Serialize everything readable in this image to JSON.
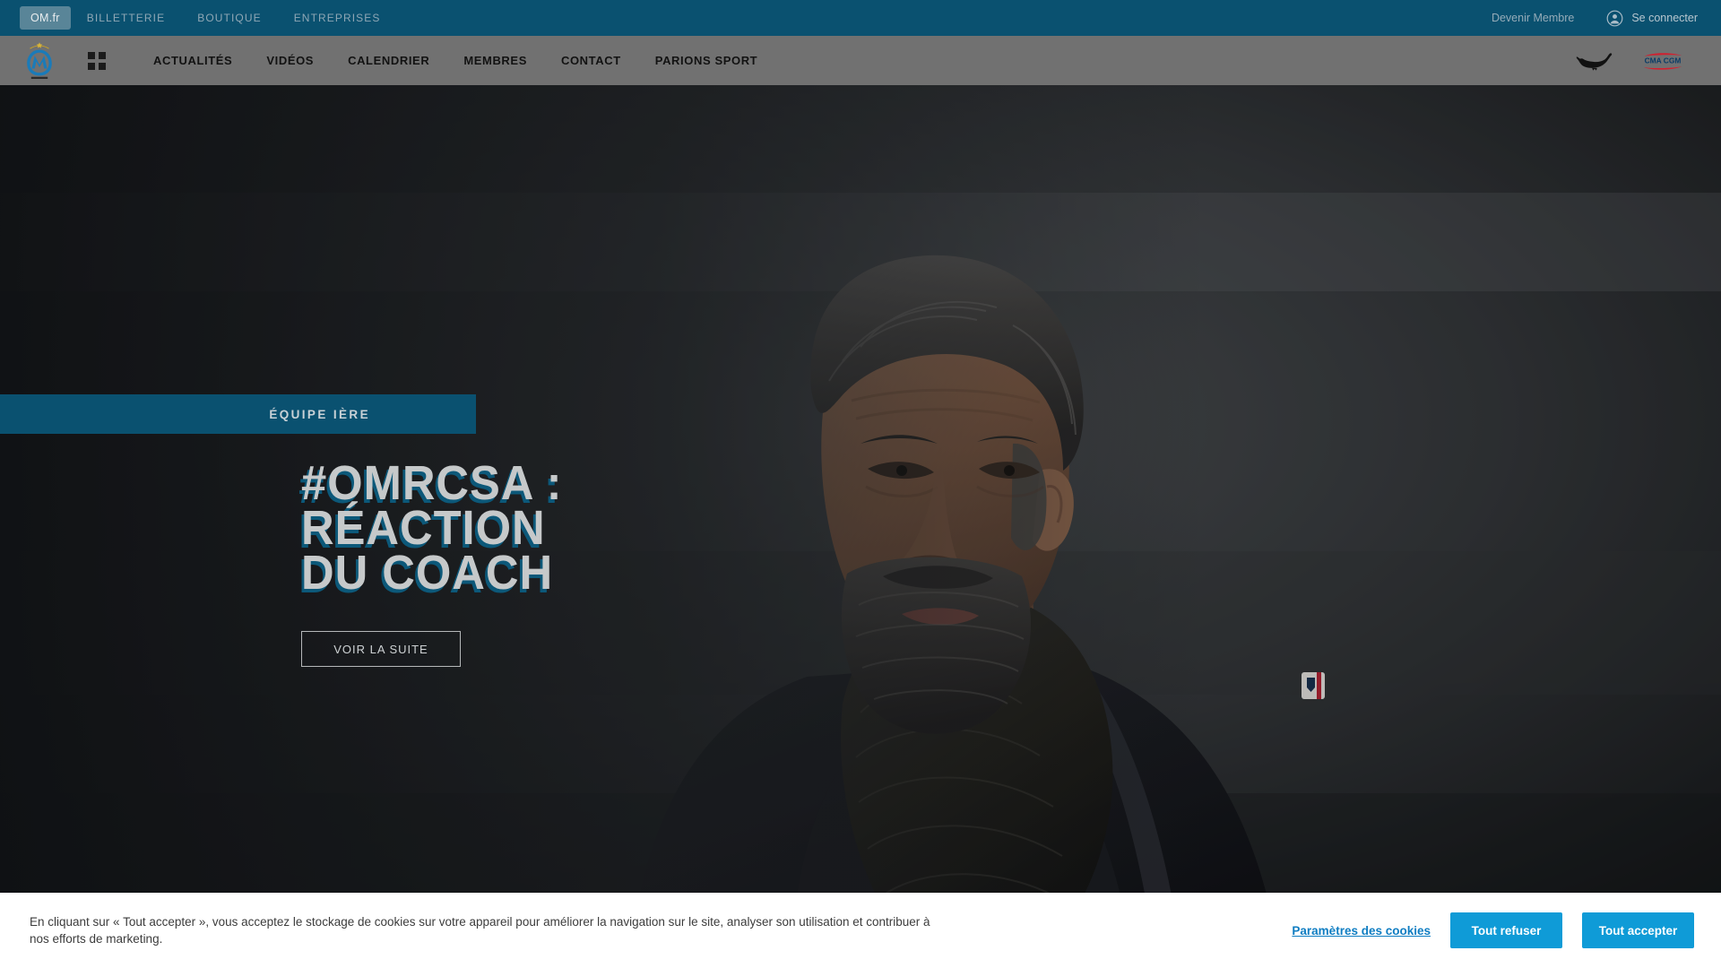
{
  "topbar": {
    "brand_pill": "OM.fr",
    "links": [
      {
        "label": "BILLETTERIE"
      },
      {
        "label": "BOUTIQUE"
      },
      {
        "label": "ENTREPRISES"
      }
    ],
    "member_link": "Devenir Membre",
    "signin_label": "Se connecter",
    "signin_icon": "user-avatar-icon",
    "background_color": "#0a5170"
  },
  "mainnav": {
    "logo_icon": "om-crest-logo",
    "grid_icon": "grid-menu-icon",
    "items": [
      {
        "label": "ACTUALITÉS"
      },
      {
        "label": "VIDÉOS"
      },
      {
        "label": "CALENDRIER"
      },
      {
        "label": "MEMBRES"
      },
      {
        "label": "CONTACT"
      },
      {
        "label": "PARIONS SPORT"
      }
    ],
    "sponsors": [
      {
        "name": "puma-logo"
      },
      {
        "name": "cma-cgm-logo",
        "text": "CMA CGM"
      }
    ],
    "background_color": "#7d7d7d"
  },
  "hero": {
    "category_badge": "ÉQUIPE IÈRE",
    "headline": "#OMRCSA :\nRÉACTION\nDU COACH",
    "cta_label": "VOIR LA SUITE",
    "badge_color": "#0a5170",
    "headline_color": "#c6c9ca",
    "headline_shadow_color": "#0c5c7e",
    "image_alt": "coach-portrait-photo"
  },
  "cookie_banner": {
    "message": "En cliquant sur « Tout accepter », vous acceptez le stockage de cookies sur votre appareil pour améliorer la navigation sur le site, analyser son utilisation et contribuer à nos efforts de marketing.",
    "settings_label": "Paramètres des cookies",
    "reject_label": "Tout refuser",
    "accept_label": "Tout accepter",
    "button_color": "#0f9bd7",
    "link_color": "#0f7dc2"
  }
}
